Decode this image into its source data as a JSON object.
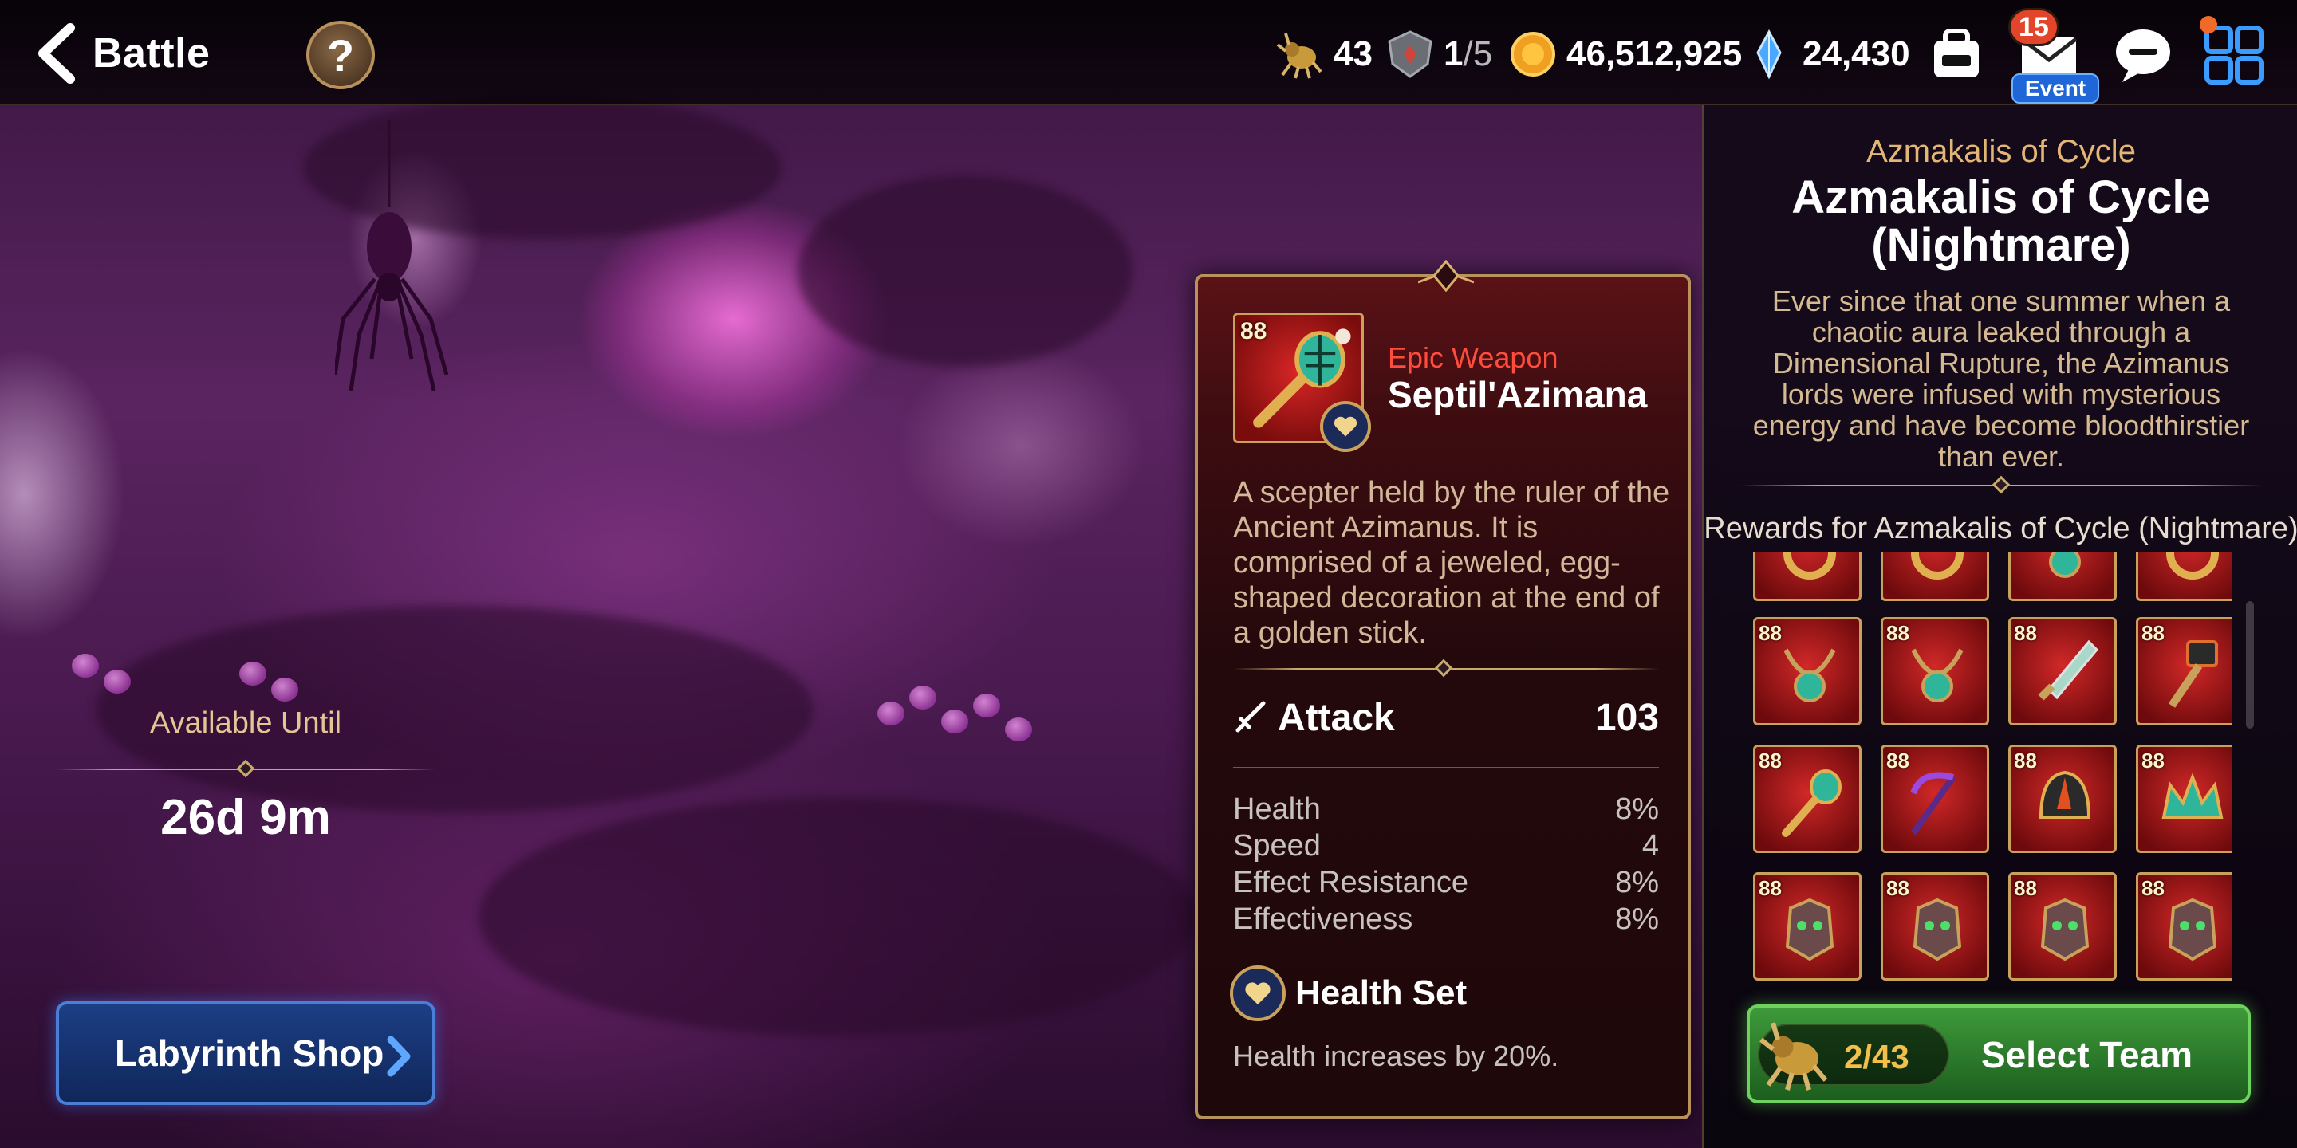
{
  "header": {
    "back_label": "Battle",
    "help_label": "?",
    "resources": {
      "stamina": "43",
      "runes_current": "1",
      "runes_max": "/5",
      "gold": "46,512,925",
      "crystals": "24,430"
    },
    "mail_badge": "15",
    "event_tag": "Event"
  },
  "left": {
    "available_label": "Available Until",
    "available_time": "26d 9m",
    "shop_label": "Labyrinth Shop"
  },
  "item": {
    "level": "88",
    "grade": "Epic Weapon",
    "name": "Septil'Azimana",
    "description": "A scepter held by the ruler of the Ancient Azimanus. It is comprised of a jeweled, egg-shaped decoration at the end of a golden stick.",
    "main_stat": {
      "label": "Attack",
      "value": "103"
    },
    "stats": [
      {
        "label": "Health",
        "value": "8%"
      },
      {
        "label": "Speed",
        "value": "4"
      },
      {
        "label": "Effect Resistance",
        "value": "8%"
      },
      {
        "label": "Effectiveness",
        "value": "8%"
      }
    ],
    "set_name": "Health Set",
    "set_effect": "Health increases by 20%.",
    "grade_color": "#ff4c3c"
  },
  "stage": {
    "subtitle": "Azmakalis of Cycle",
    "title_line1": "Azmakalis of Cycle",
    "title_line2": "(Nightmare)",
    "description": "Ever since that one summer when a chaotic aura leaked through a Dimensional Rupture, the Azimanus lords were infused with mysterious energy and have become bloodthirstier than ever.",
    "rewards_title": "Rewards for Azmakalis of Cycle (Nightmare)",
    "rewards": [
      {
        "level": "",
        "icon": "ring-icon"
      },
      {
        "level": "",
        "icon": "ring-icon"
      },
      {
        "level": "",
        "icon": "necklace-icon"
      },
      {
        "level": "",
        "icon": "ring-icon"
      },
      {
        "level": "88",
        "icon": "necklace-icon"
      },
      {
        "level": "88",
        "icon": "necklace-icon"
      },
      {
        "level": "88",
        "icon": "sword-icon"
      },
      {
        "level": "88",
        "icon": "hammer-icon"
      },
      {
        "level": "88",
        "icon": "scepter-icon"
      },
      {
        "level": "88",
        "icon": "scythe-icon"
      },
      {
        "level": "88",
        "icon": "helmet-icon"
      },
      {
        "level": "88",
        "icon": "crown-icon"
      },
      {
        "level": "88",
        "icon": "armor-icon"
      },
      {
        "level": "88",
        "icon": "armor-icon"
      },
      {
        "level": "88",
        "icon": "armor-icon"
      },
      {
        "level": "88",
        "icon": "armor-icon"
      }
    ],
    "team_count": "2/43",
    "team_button": "Select Team"
  }
}
